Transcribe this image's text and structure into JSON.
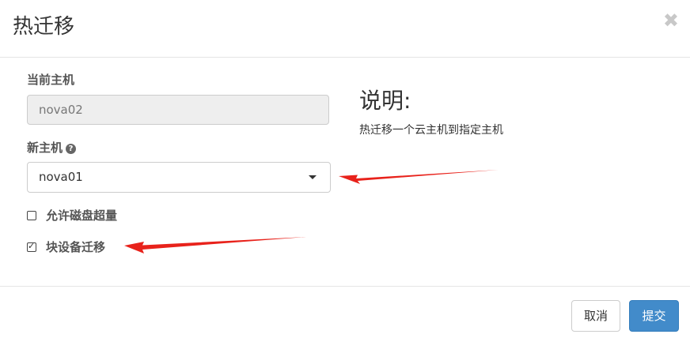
{
  "dialog": {
    "title": "热迁移",
    "close_glyph": "✖"
  },
  "form": {
    "current_host_label": "当前主机",
    "current_host_value": "nova02",
    "new_host_label": "新主机",
    "new_host_help_glyph": "?",
    "new_host_selected": "nova01",
    "options": [
      {
        "label": "允许磁盘超量",
        "checked": false
      },
      {
        "label": "块设备迁移",
        "checked": true
      }
    ]
  },
  "description": {
    "title": "说明:",
    "text": "热迁移一个云主机到指定主机"
  },
  "footer": {
    "cancel_label": "取消",
    "submit_label": "提交"
  },
  "colors": {
    "primary": "#428bca",
    "annotation_arrow": "#e8221b"
  },
  "icons": [
    "close-icon",
    "help-icon",
    "caret-down-icon",
    "checkbox-unchecked-icon",
    "checkbox-checked-icon",
    "annotation-arrow"
  ]
}
